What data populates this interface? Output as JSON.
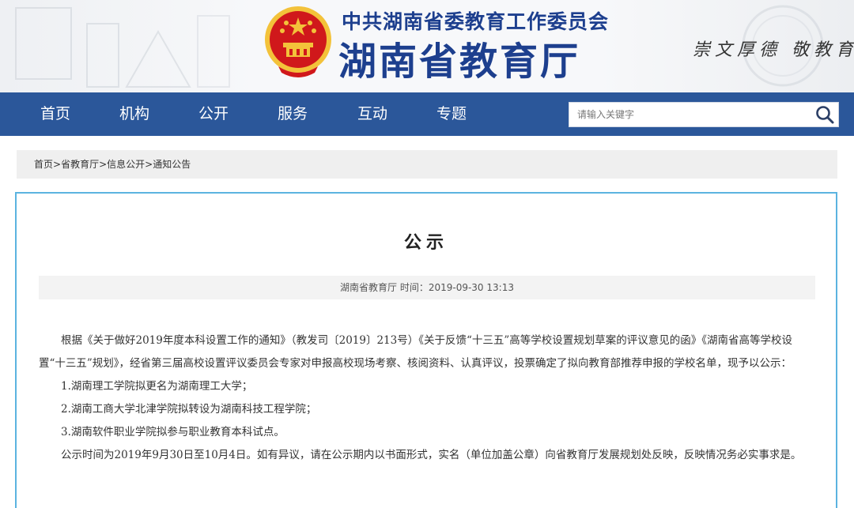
{
  "header": {
    "org_small": "中共湖南省委教育工作委员会",
    "org_big": "湖南省教育厅",
    "motto": "崇文厚德 敬教育才"
  },
  "nav": {
    "items": [
      "首页",
      "机构",
      "公开",
      "服务",
      "互动",
      "专题"
    ],
    "search_placeholder": "请输入关键字"
  },
  "breadcrumb": {
    "items": [
      "首页",
      "省教育厅",
      "信息公开",
      "通知公告"
    ],
    "separator": ">"
  },
  "article": {
    "title": "公示",
    "meta": "湖南省教育厅  时间：2019-09-30 13:13",
    "paragraph1": "根据《关于做好2019年度本科设置工作的通知》（教发司〔2019〕213号）《关于反馈“十三五”高等学校设置规划草案的评议意见的函》《湖南省高等学校设置“十三五”规划》，经省第三届高校设置评议委员会专家对申报高校现场考察、核阅资料、认真评议，投票确定了拟向教育部推荐申报的学校名单，现予以公示：",
    "items": [
      "1.湖南理工学院拟更名为湖南理工大学；",
      "2.湖南工商大学北津学院拟转设为湖南科技工程学院；",
      "3.湖南软件职业学院拟参与职业教育本科试点。"
    ],
    "paragraph2": "公示时间为2019年9月30日至10月4日。如有异议，请在公示期内以书面形式，实名（单位加盖公章）向省教育厅发展规划处反映，反映情况务必实事求是。"
  },
  "colors": {
    "nav_bg": "#2b579a",
    "brand_text": "#1d3f8e",
    "panel_border": "#5bb3e0",
    "emblem_red": "#d0181b",
    "emblem_gold": "#f3c23a"
  }
}
